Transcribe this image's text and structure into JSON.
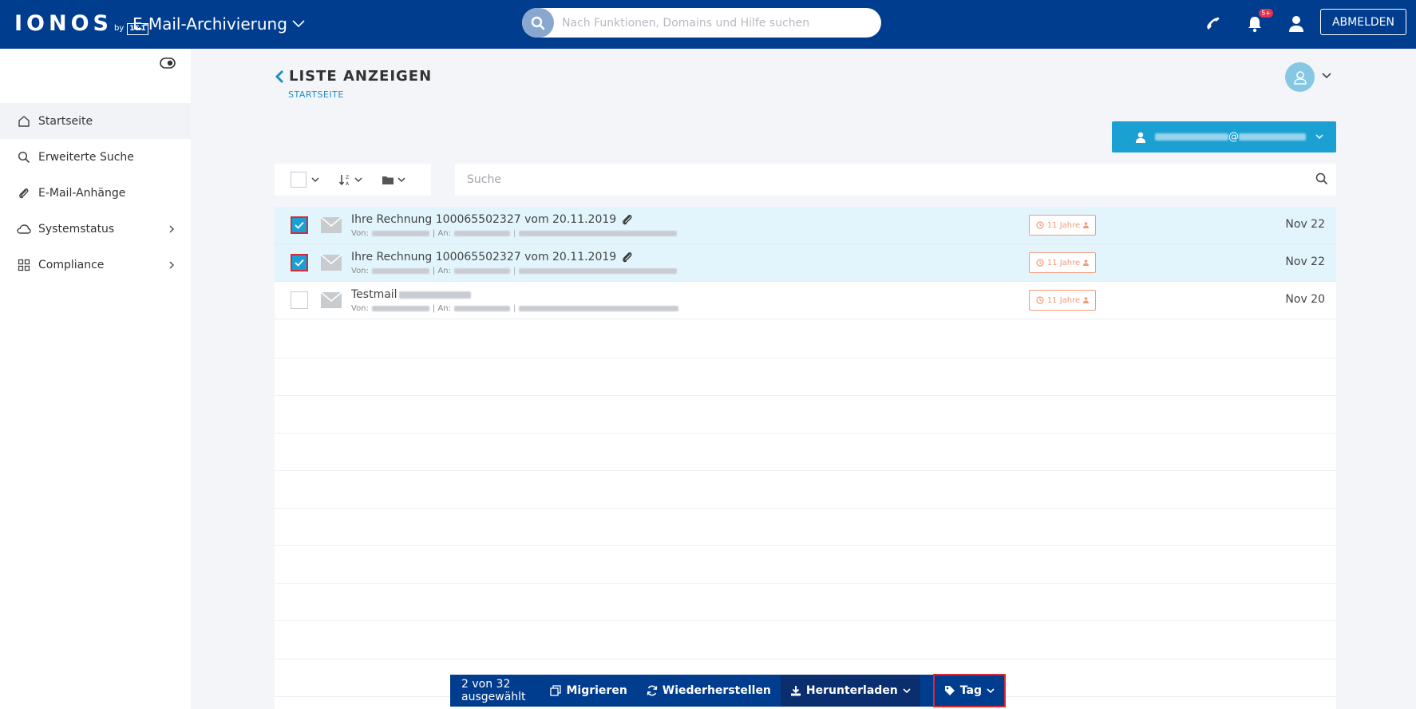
{
  "header": {
    "logo_main": "IONOS",
    "logo_by": "by",
    "logo_box": "1&1",
    "app_title": "E-Mail-Archivierung",
    "search_placeholder": "Nach Funktionen, Domains und Hilfe suchen",
    "notification_badge": "5+",
    "logout_label": "ABMELDEN"
  },
  "sidebar": {
    "items": [
      {
        "label": "Startseite",
        "icon": "home-icon",
        "active": true
      },
      {
        "label": "Erweiterte Suche",
        "icon": "search-icon",
        "active": false
      },
      {
        "label": "E-Mail-Anhänge",
        "icon": "paperclip-icon",
        "active": false
      },
      {
        "label": "Systemstatus",
        "icon": "cloud-icon",
        "active": false,
        "expandable": true
      },
      {
        "label": "Compliance",
        "icon": "grid-icon",
        "active": false,
        "expandable": true
      }
    ]
  },
  "main": {
    "title": "LISTE ANZEIGEN",
    "breadcrumb": "STARTSEITE",
    "account_visible": "@",
    "search_placeholder": "Suche",
    "emails": [
      {
        "subject": "Ihre Rechnung 100065502327 vom 20.11.2019",
        "from_label": "Von:",
        "to_label": "| An:",
        "retention": "11 Jahre",
        "date": "Nov 22",
        "selected": true,
        "attachment": true
      },
      {
        "subject": "Ihre Rechnung 100065502327 vom 20.11.2019",
        "from_label": "Von:",
        "to_label": "| An:",
        "retention": "11 Jahre",
        "date": "Nov 22",
        "selected": true,
        "attachment": true
      },
      {
        "subject": "Testmail",
        "from_label": "Von:",
        "to_label": "| An:",
        "retention": "11 Jahre",
        "date": "Nov 20",
        "selected": false,
        "attachment": false
      }
    ]
  },
  "actionbar": {
    "selection_count": "2 von 32 ausgewählt",
    "migrate": "Migrieren",
    "restore": "Wiederherstellen",
    "download": "Herunterladen",
    "tag": "Tag"
  },
  "colors": {
    "brand": "#003d8f",
    "accent": "#1ba0d3",
    "retention": "#f39a78",
    "highlight": "#d62a35"
  }
}
